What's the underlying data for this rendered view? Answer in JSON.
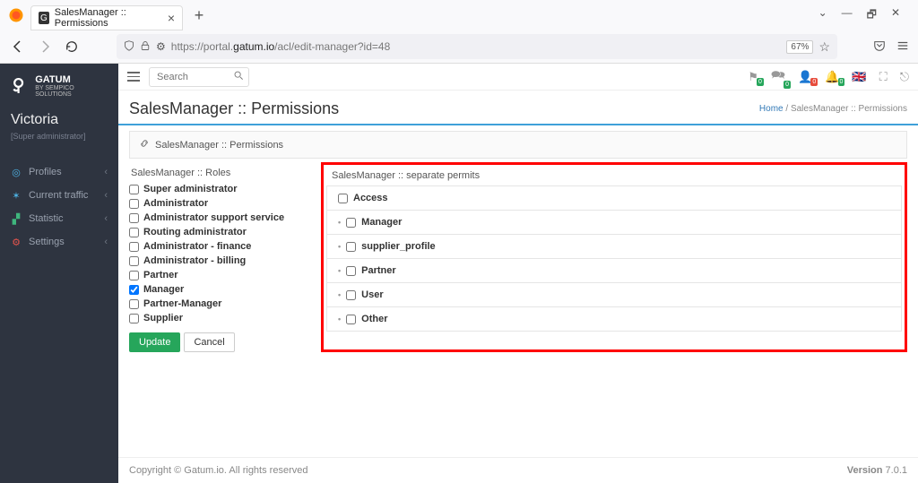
{
  "browser": {
    "tab_title": "SalesManager :: Permissions",
    "url_prefix": "https://portal.",
    "url_domain": "gatum.io",
    "url_path": "/acl/edit-manager?id=48",
    "zoom": "67%"
  },
  "sidebar": {
    "brand_top": "GATUM",
    "brand_sub": "BY SEMPICO SOLUTIONS",
    "username": "Victoria",
    "user_role": "[Super administrator]",
    "items": [
      {
        "label": "Profiles"
      },
      {
        "label": "Current traffic"
      },
      {
        "label": "Statistic"
      },
      {
        "label": "Settings"
      }
    ]
  },
  "topbar": {
    "search_placeholder": "Search",
    "badges": [
      "0",
      "0",
      "0",
      "0"
    ]
  },
  "page": {
    "title": "SalesManager :: Permissions",
    "breadcrumb_home": "Home",
    "breadcrumb_current": "SalesManager :: Permissions",
    "sub_header": "SalesManager :: Permissions",
    "roles_title": "SalesManager :: Roles",
    "roles": [
      {
        "label": "Super administrator",
        "checked": false
      },
      {
        "label": "Administrator",
        "checked": false
      },
      {
        "label": "Administrator support service",
        "checked": false
      },
      {
        "label": "Routing administrator",
        "checked": false
      },
      {
        "label": "Administrator - finance",
        "checked": false
      },
      {
        "label": "Administrator - billing",
        "checked": false
      },
      {
        "label": "Partner",
        "checked": false
      },
      {
        "label": "Manager",
        "checked": true
      },
      {
        "label": "Partner-Manager",
        "checked": false
      },
      {
        "label": "Supplier",
        "checked": false
      }
    ],
    "update_btn": "Update",
    "cancel_btn": "Cancel",
    "permits_title": "SalesManager :: separate permits",
    "permits": [
      {
        "label": "Access",
        "indent": false
      },
      {
        "label": "Manager",
        "indent": true
      },
      {
        "label": "supplier_profile",
        "indent": true
      },
      {
        "label": "Partner",
        "indent": true
      },
      {
        "label": "User",
        "indent": true
      },
      {
        "label": "Other",
        "indent": true
      }
    ]
  },
  "footer": {
    "copyright": "Copyright © Gatum.io. All rights reserved",
    "version_label": "Version ",
    "version": "7.0.1"
  }
}
